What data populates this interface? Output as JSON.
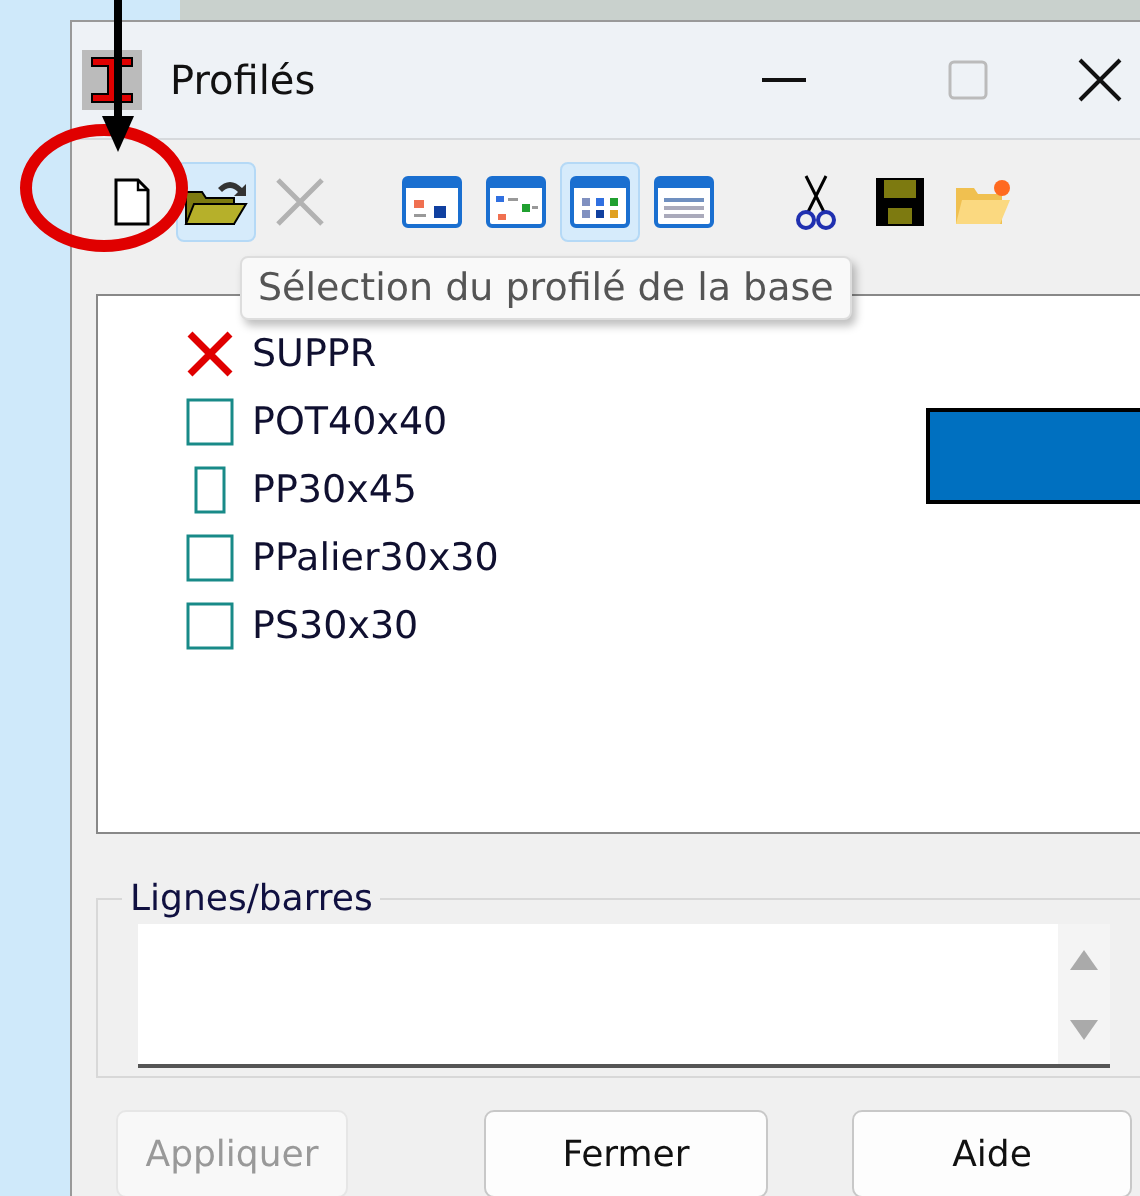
{
  "window": {
    "title": "Profilés"
  },
  "toolbar": [
    {
      "kind": "new",
      "selected": false,
      "disabled": false
    },
    {
      "kind": "open",
      "selected": true,
      "disabled": false
    },
    {
      "kind": "delete",
      "selected": false,
      "disabled": true
    },
    {
      "kind": "view1",
      "selected": false,
      "disabled": false
    },
    {
      "kind": "view2",
      "selected": false,
      "disabled": false
    },
    {
      "kind": "view3",
      "selected": true,
      "disabled": false
    },
    {
      "kind": "view4",
      "selected": false,
      "disabled": false
    },
    {
      "kind": "cut",
      "selected": false,
      "disabled": false
    },
    {
      "kind": "save",
      "selected": false,
      "disabled": false
    },
    {
      "kind": "folder",
      "selected": false,
      "disabled": false
    }
  ],
  "tooltip": "Sélection du profilé de la base",
  "profiles": [
    {
      "kind": "deleted",
      "name": "SUPPR"
    },
    {
      "kind": "square",
      "name": "POT40x40"
    },
    {
      "kind": "rect",
      "name": "PP30x45"
    },
    {
      "kind": "square",
      "name": "PPalier30x30"
    },
    {
      "kind": "square",
      "name": "PS30x30"
    }
  ],
  "group": {
    "label": "Lignes/barres"
  },
  "buttons": [
    {
      "label": "Appliquer",
      "disabled": true
    },
    {
      "label": "Fermer",
      "disabled": false
    },
    {
      "label": "Aide",
      "disabled": false
    }
  ]
}
